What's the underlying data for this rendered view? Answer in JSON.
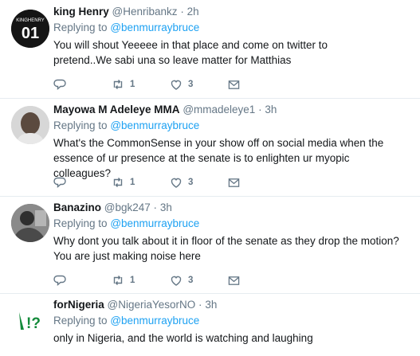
{
  "tweets": [
    {
      "name": "king Henry",
      "handle": "@Henribankz",
      "time": "2h",
      "replying_to_prefix": "Replying to",
      "replying_to": "@benmurraybruce",
      "text": "You will shout Yeeeee in that place and come on twitter to pretend..We sabi una so leave matter for Matthias",
      "retweets": "1",
      "likes": "3",
      "avatar_text": "01",
      "avatar_top_text": "KINGHENRY"
    },
    {
      "name": "Mayowa M Adeleye MMA",
      "handle": "@mmadeleye1",
      "time": "3h",
      "replying_to_prefix": "Replying to",
      "replying_to": "@benmurraybruce",
      "text": "What's the CommonSense in your show off on social media when the essence of ur presence at the senate is to enlighten ur myopic colleagues?",
      "retweets": "1",
      "likes": "3"
    },
    {
      "name": "Banazino",
      "handle": "@bgk247",
      "time": "3h",
      "replying_to_prefix": "Replying to",
      "replying_to": "@benmurraybruce",
      "text": "Why dont you talk about it in floor of the senate as they drop the motion?  You are just making noise here",
      "retweets": "1",
      "likes": "3"
    },
    {
      "name": "forNigeria",
      "handle": "@NigeriaYesorNO",
      "time": "3h",
      "replying_to_prefix": "Replying to",
      "replying_to": "@benmurraybruce",
      "text": "only in Nigeria, and the world is watching and laughing",
      "avatar_text": "!?"
    }
  ],
  "colors": {
    "link": "#1da1f2",
    "muted": "#657786",
    "divider": "#e6ecf0"
  },
  "icons": [
    "reply-icon",
    "retweet-icon",
    "like-icon",
    "direct-message-icon"
  ]
}
